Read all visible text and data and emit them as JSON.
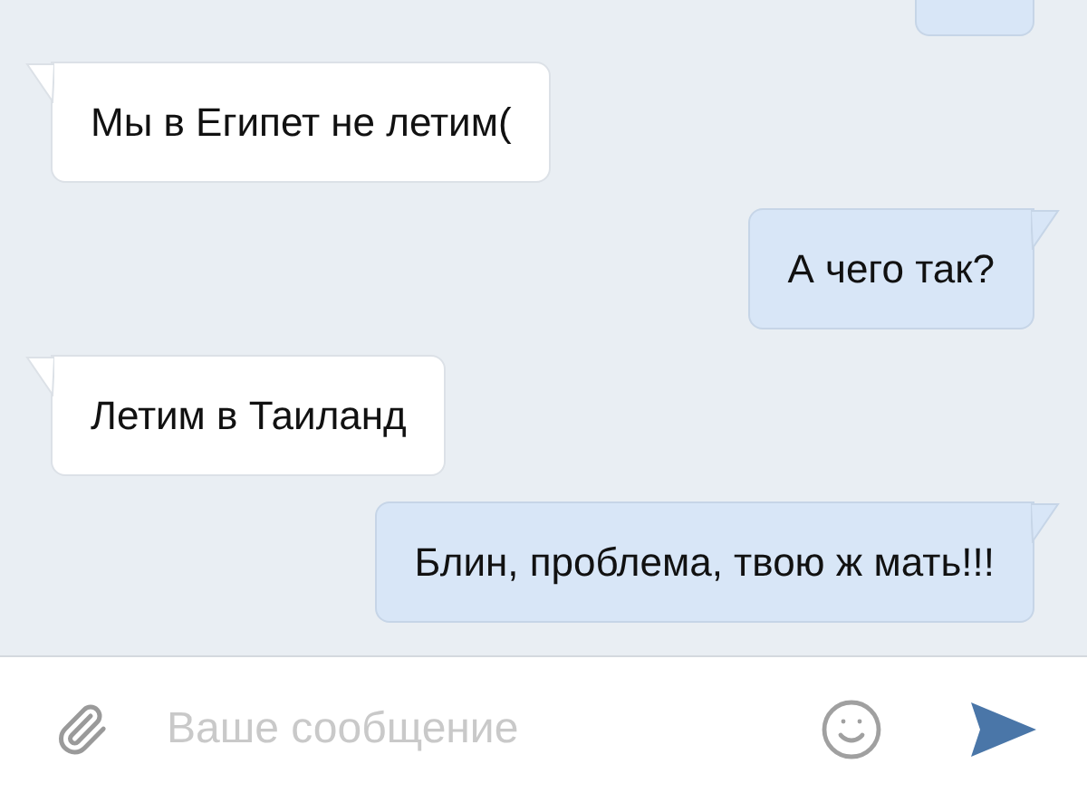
{
  "messages": [
    {
      "kind": "partial",
      "outgoing": true
    },
    {
      "kind": "text",
      "outgoing": false,
      "text": "Мы в Египет не летим("
    },
    {
      "kind": "text",
      "outgoing": true,
      "text": "А чего так?"
    },
    {
      "kind": "text",
      "outgoing": false,
      "text": "Летим в Таиланд"
    },
    {
      "kind": "text",
      "outgoing": true,
      "text": "Блин, проблема, твою ж мать!!!"
    }
  ],
  "composer": {
    "placeholder": "Ваше сообщение"
  }
}
